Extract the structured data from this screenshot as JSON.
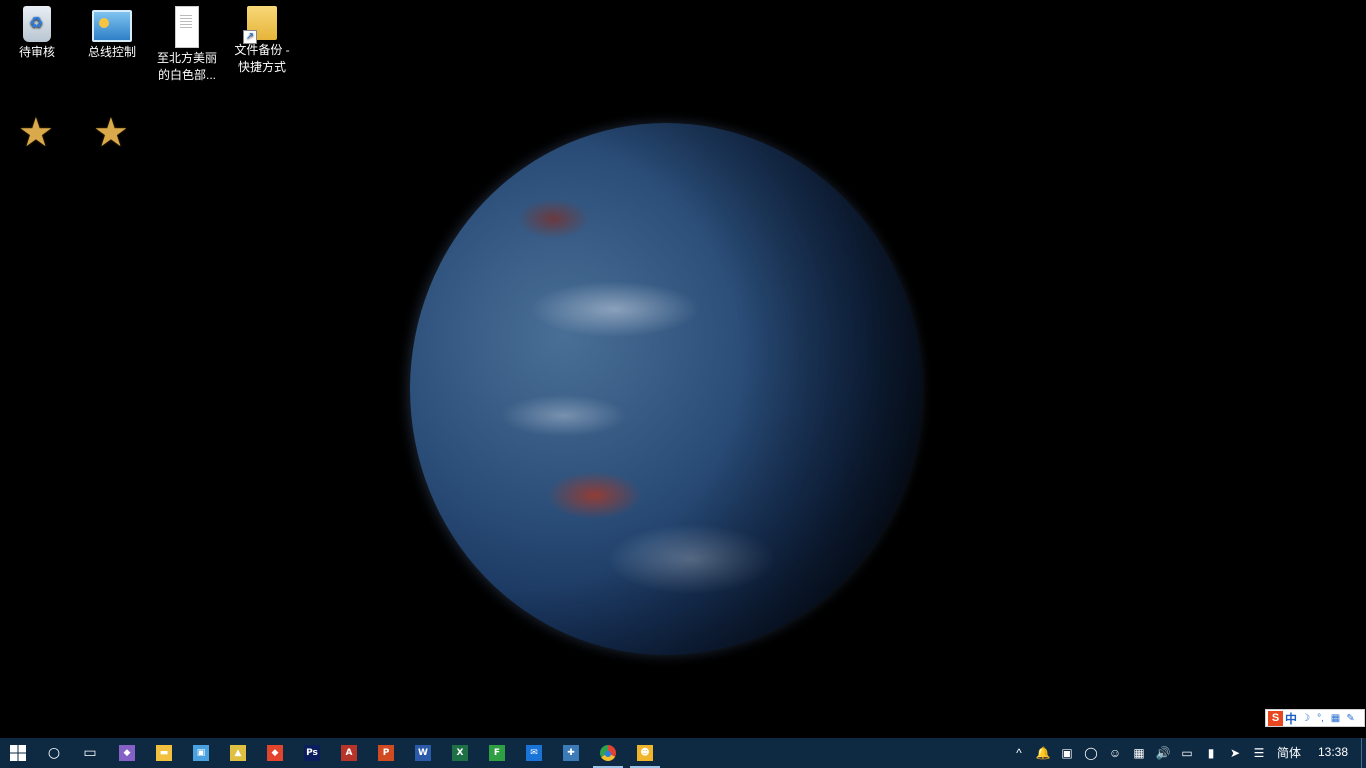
{
  "desktop": {
    "icons": [
      {
        "label": "待审核"
      },
      {
        "label": "总线控制"
      },
      {
        "label": "至北方美丽的白色部..."
      },
      {
        "label": "文件备份 - 快捷方式"
      }
    ]
  },
  "ime_bar": {
    "logo": "S",
    "mode": "中",
    "items": [
      "☽",
      "°,",
      "▦",
      "✎"
    ]
  },
  "taskbar": {
    "apps": [
      {
        "name": "cortana-icon",
        "glyph": "○"
      },
      {
        "name": "task-view-icon",
        "glyph": "▭"
      },
      {
        "name": "visual-studio-icon",
        "glyph": "◆",
        "color": "#8661c5"
      },
      {
        "name": "file-explorer-icon",
        "glyph": "▬",
        "color": "#f3c140"
      },
      {
        "name": "network-tool-icon",
        "glyph": "▣",
        "color": "#49a1e0"
      },
      {
        "name": "python-launcher-icon",
        "glyph": "▲",
        "color": "#e0c040"
      },
      {
        "name": "git-icon",
        "glyph": "◆",
        "color": "#e1452c"
      },
      {
        "name": "photoshop-icon",
        "glyph": "Ps",
        "color": "#0a1d5c"
      },
      {
        "name": "access-icon",
        "glyph": "A",
        "color": "#b7342b"
      },
      {
        "name": "powerpoint-icon",
        "glyph": "P",
        "color": "#d04a22"
      },
      {
        "name": "word-icon",
        "glyph": "W",
        "color": "#2b5ba8"
      },
      {
        "name": "excel-icon",
        "glyph": "X",
        "color": "#1e7145"
      },
      {
        "name": "green-app-icon",
        "glyph": "F",
        "color": "#2ea043"
      },
      {
        "name": "outlook-icon",
        "glyph": "✉",
        "color": "#1a73d6"
      },
      {
        "name": "python-icon",
        "glyph": "✚",
        "color": "#3d7ab8"
      },
      {
        "name": "chrome-icon",
        "glyph": "●",
        "color": "#e34133"
      },
      {
        "name": "qq-icon",
        "glyph": "☻",
        "color": "#f0b52a"
      }
    ],
    "tray": [
      "^",
      "🔔",
      "▣",
      "◯",
      "☺",
      "▦",
      "🔊",
      "▭",
      "▮",
      "➤",
      "☰"
    ],
    "language": "简体",
    "clock": "13:38"
  }
}
